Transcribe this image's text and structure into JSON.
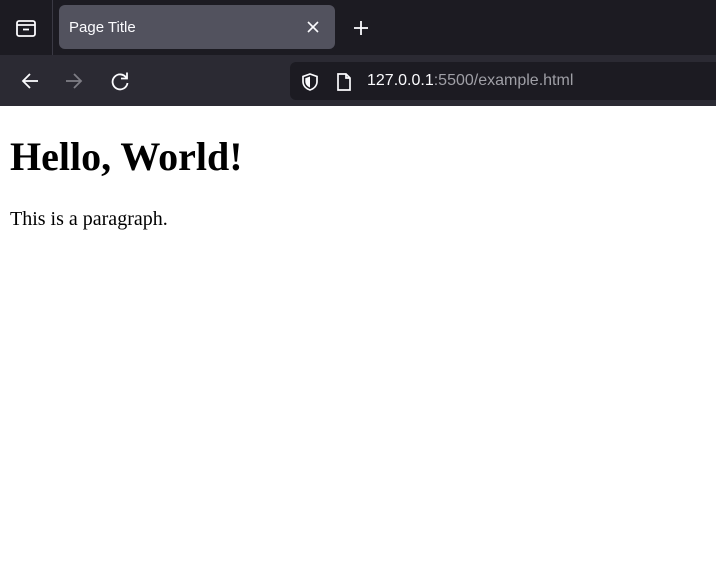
{
  "tabs": [
    {
      "title": "Page Title",
      "active": true
    }
  ],
  "toolbar": {
    "url_host": "127.0.0.1",
    "url_rest": ":5500/example.html"
  },
  "page": {
    "heading": "Hello, World!",
    "paragraph": "This is a paragraph."
  },
  "icons": {
    "tab_overview": "tab-overview-icon",
    "tab_close": "close-icon",
    "new_tab": "plus-icon",
    "back": "arrow-left-icon",
    "forward": "arrow-right-icon",
    "reload": "reload-icon",
    "tracking_protection": "shield-icon",
    "page_info": "page-icon"
  },
  "colors": {
    "tabbar_bg": "#1c1b22",
    "active_tab_bg": "#52525e",
    "toolbar_bg": "#2b2a33",
    "urlbar_bg": "#1c1b22",
    "url_host": "#fbfbfe",
    "url_rest": "#9f9fa6"
  }
}
